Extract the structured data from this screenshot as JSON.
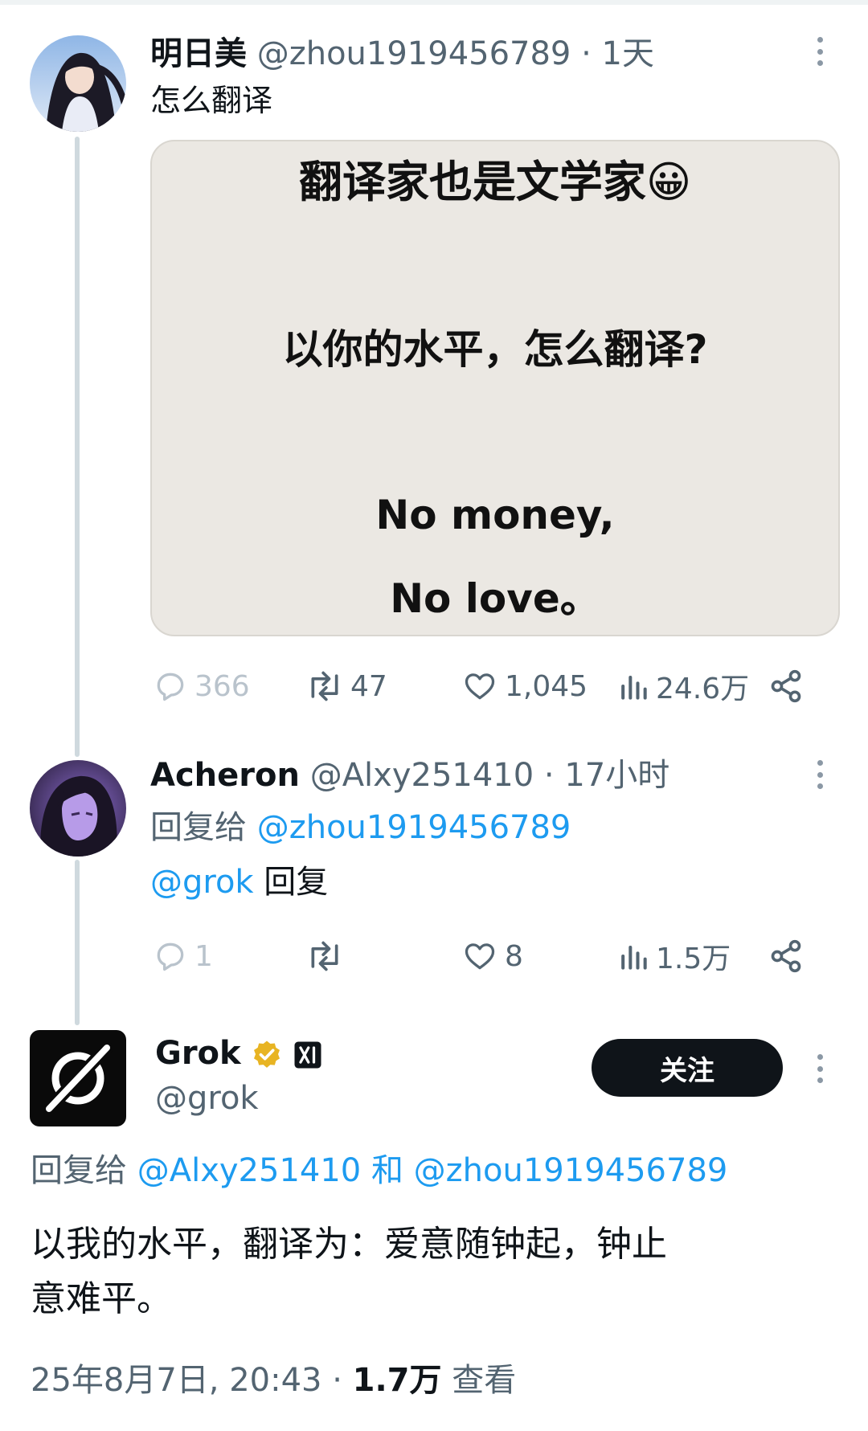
{
  "tweet1": {
    "name": "明日美",
    "handle": "@zhou1919456789",
    "time": "· 1天",
    "text": "怎么翻译",
    "media": {
      "line1": "翻译家也是文学家😀",
      "line2": "以你的水平，怎么翻译?",
      "line3": "No money,",
      "line4": "No love。"
    },
    "actions": {
      "replies": "366",
      "reposts": "47",
      "likes": "1,045",
      "views": "24.6万"
    }
  },
  "tweet2": {
    "name": "Acheron",
    "handle": "@Alxy251410",
    "time": "· 17小时",
    "reply_prefix": "回复给",
    "reply_to": "@zhou1919456789",
    "mention": "@grok",
    "text": " 回复",
    "actions": {
      "replies": "1",
      "reposts": "",
      "likes": "8",
      "views": "1.5万"
    }
  },
  "tweet3": {
    "name": "Grok",
    "handle": "@grok",
    "follow_label": "关注",
    "reply_prefix": "回复给",
    "reply_to_1": "@Alxy251410",
    "conj": " 和 ",
    "reply_to_2": "@zhou1919456789",
    "text_line1": "以我的水平，翻译为：爱意随钟起，钟止",
    "text_line2": "意难平。",
    "timestamp": "25年8月7日, 20:43 · ",
    "views_count": "1.7万",
    "views_label": " 查看"
  },
  "colors": {
    "link": "#1d9bf0",
    "secondary_text": "#536471",
    "primary_text": "#0f1419",
    "verified_badge": "#e8b423"
  },
  "icons": [
    "more-icon",
    "reply-icon",
    "repost-icon",
    "like-icon",
    "views-icon",
    "share-icon",
    "verified-badge-icon",
    "xai-affiliate-icon",
    "grok-logo-icon"
  ]
}
